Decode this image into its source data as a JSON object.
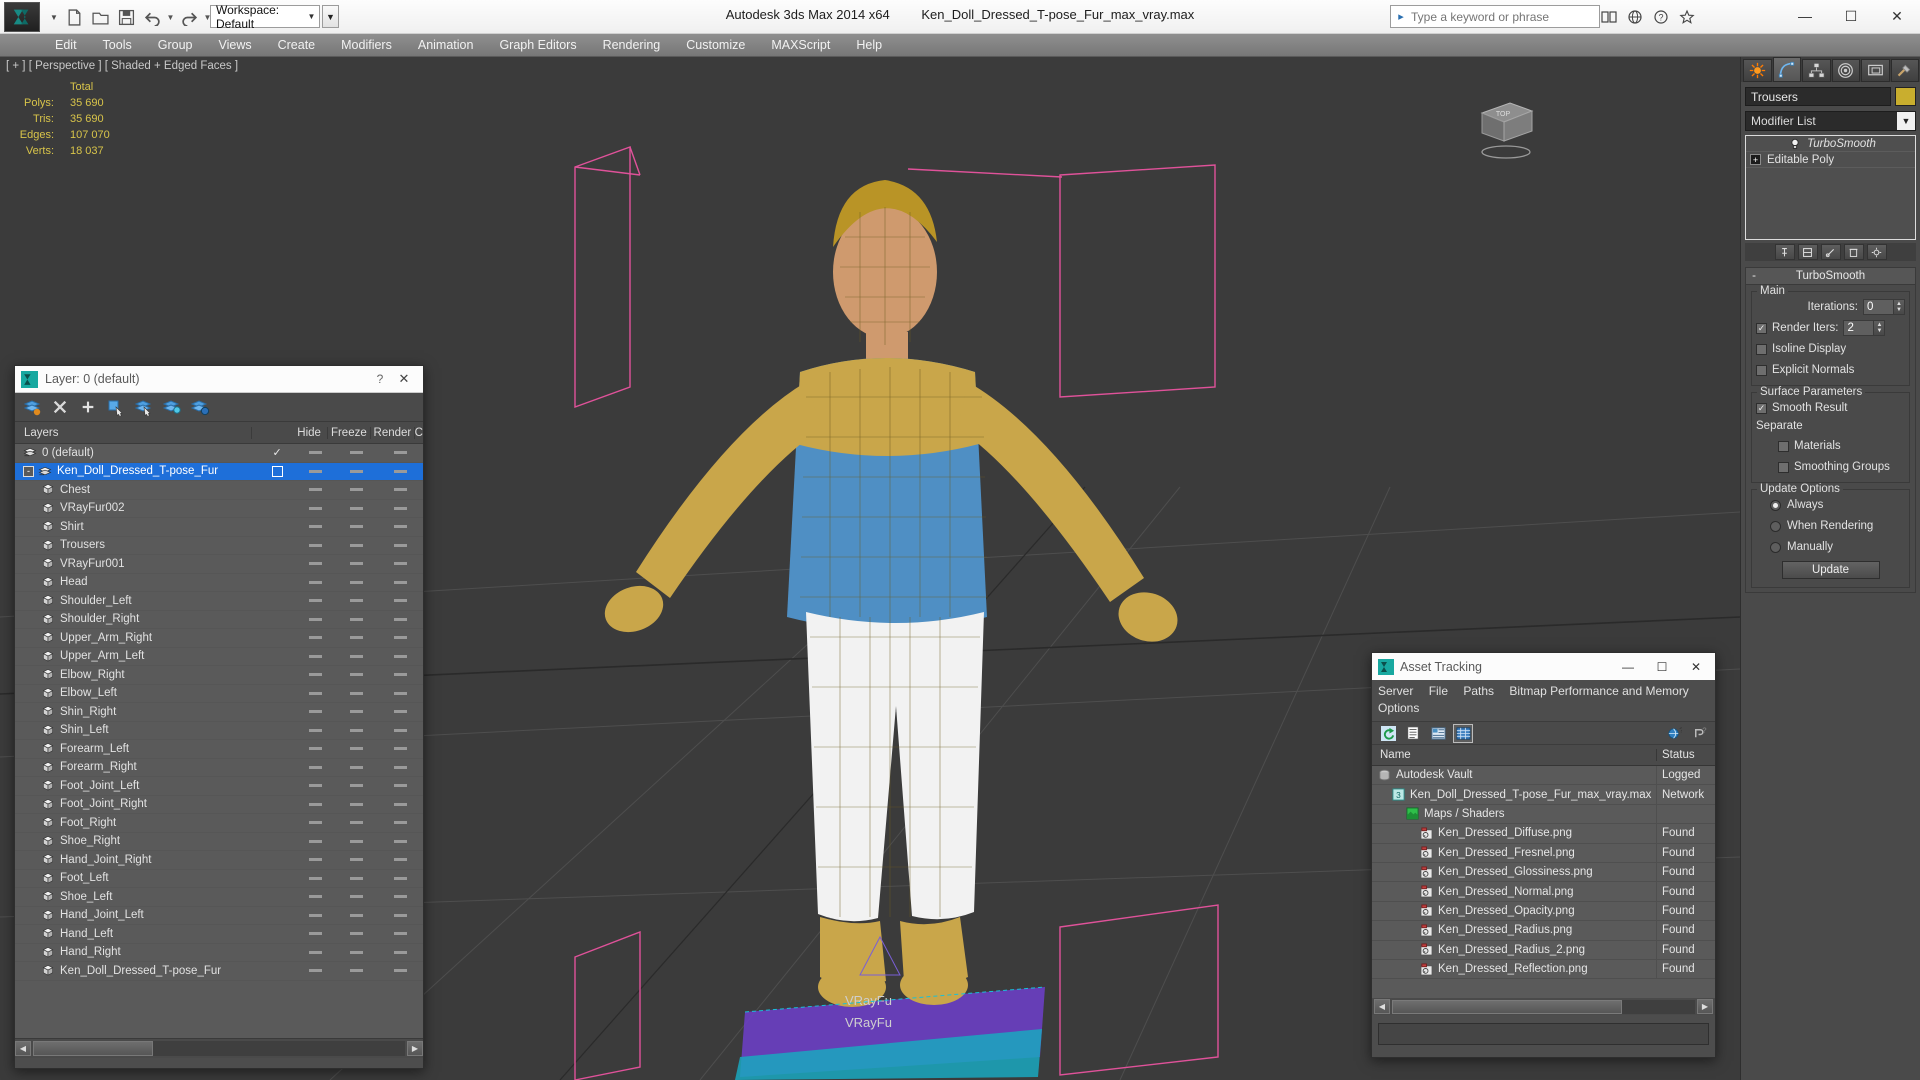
{
  "titlebar": {
    "app_title": "Autodesk 3ds Max  2014 x64",
    "file_title": "Ken_Doll_Dressed_T-pose_Fur_max_vray.max",
    "workspace": "Workspace: Default",
    "search_placeholder": "Type a keyword or phrase",
    "minimize": "—",
    "maximize": "☐",
    "close": "✕"
  },
  "menubar": {
    "items": [
      "Edit",
      "Tools",
      "Group",
      "Views",
      "Create",
      "Modifiers",
      "Animation",
      "Graph Editors",
      "Rendering",
      "Customize",
      "MAXScript",
      "Help"
    ]
  },
  "viewport": {
    "label": "[ + ] [ Perspective ] [ Shaded + Edged Faces ]",
    "stats_header": "Total",
    "stats": [
      {
        "label": "Polys:",
        "value": "35 690"
      },
      {
        "label": "Tris:",
        "value": "35 690"
      },
      {
        "label": "Edges:",
        "value": "107 070"
      },
      {
        "label": "Verts:",
        "value": "18 037"
      }
    ],
    "scene_labels": [
      "VRayFu",
      "VRayFu"
    ],
    "viewcube_label": "TOP"
  },
  "layer_dialog": {
    "title": "Layer: 0 (default)",
    "help_glyph": "?",
    "close_glyph": "✕",
    "columns": [
      "Layers",
      "",
      "Hide",
      "Freeze",
      "Render",
      "C"
    ],
    "rows": [
      {
        "name": "0 (default)",
        "indent": 0,
        "expander": "",
        "selected": false,
        "current": "check",
        "type": "layer"
      },
      {
        "name": "Ken_Doll_Dressed_T-pose_Fur",
        "indent": 0,
        "expander": "-",
        "selected": true,
        "current": "box",
        "type": "layer"
      },
      {
        "name": "Chest",
        "indent": 1,
        "type": "object"
      },
      {
        "name": "VRayFur002",
        "indent": 1,
        "type": "object"
      },
      {
        "name": "Shirt",
        "indent": 1,
        "type": "object"
      },
      {
        "name": "Trousers",
        "indent": 1,
        "type": "object"
      },
      {
        "name": "VRayFur001",
        "indent": 1,
        "type": "object"
      },
      {
        "name": "Head",
        "indent": 1,
        "type": "object"
      },
      {
        "name": "Shoulder_Left",
        "indent": 1,
        "type": "object"
      },
      {
        "name": "Shoulder_Right",
        "indent": 1,
        "type": "object"
      },
      {
        "name": "Upper_Arm_Right",
        "indent": 1,
        "type": "object"
      },
      {
        "name": "Upper_Arm_Left",
        "indent": 1,
        "type": "object"
      },
      {
        "name": "Elbow_Right",
        "indent": 1,
        "type": "object"
      },
      {
        "name": "Elbow_Left",
        "indent": 1,
        "type": "object"
      },
      {
        "name": "Shin_Right",
        "indent": 1,
        "type": "object"
      },
      {
        "name": "Shin_Left",
        "indent": 1,
        "type": "object"
      },
      {
        "name": "Forearm_Left",
        "indent": 1,
        "type": "object"
      },
      {
        "name": "Forearm_Right",
        "indent": 1,
        "type": "object"
      },
      {
        "name": "Foot_Joint_Left",
        "indent": 1,
        "type": "object"
      },
      {
        "name": "Foot_Joint_Right",
        "indent": 1,
        "type": "object"
      },
      {
        "name": "Foot_Right",
        "indent": 1,
        "type": "object"
      },
      {
        "name": "Shoe_Right",
        "indent": 1,
        "type": "object"
      },
      {
        "name": "Hand_Joint_Right",
        "indent": 1,
        "type": "object"
      },
      {
        "name": "Foot_Left",
        "indent": 1,
        "type": "object"
      },
      {
        "name": "Shoe_Left",
        "indent": 1,
        "type": "object"
      },
      {
        "name": "Hand_Joint_Left",
        "indent": 1,
        "type": "object"
      },
      {
        "name": "Hand_Left",
        "indent": 1,
        "type": "object"
      },
      {
        "name": "Hand_Right",
        "indent": 1,
        "type": "object"
      },
      {
        "name": "Ken_Doll_Dressed_T-pose_Fur",
        "indent": 1,
        "type": "object"
      }
    ],
    "toolbar_icons": [
      "new-layer-icon",
      "delete-layer-icon",
      "add-layer-icon",
      "select-objects-icon",
      "select-highlighted-layer-icon",
      "highlight-selected-objects-icon",
      "layer-properties-icon"
    ]
  },
  "asset_tracking": {
    "title": "Asset Tracking",
    "minimize": "—",
    "maximize": "☐",
    "close": "✕",
    "menu": [
      "Server",
      "File",
      "Paths",
      "Bitmap Performance and Memory",
      "Options"
    ],
    "toolbar_icons": [
      "refresh-icon",
      "list-view-icon",
      "detail-view-icon",
      "grid-view-icon",
      "help-globe-icon",
      "help-icon"
    ],
    "columns": [
      "Name",
      "Status"
    ],
    "rows": [
      {
        "name": "Autodesk Vault",
        "status": "Logged",
        "indent": 0,
        "icon": "vault-icon"
      },
      {
        "name": "Ken_Doll_Dressed_T-pose_Fur_max_vray.max",
        "status": "Network",
        "indent": 1,
        "icon": "max-file-icon"
      },
      {
        "name": "Maps / Shaders",
        "status": "",
        "indent": 2,
        "icon": "maps-icon"
      },
      {
        "name": "Ken_Dressed_Diffuse.png",
        "status": "Found",
        "indent": 3,
        "icon": "bitmap-icon"
      },
      {
        "name": "Ken_Dressed_Fresnel.png",
        "status": "Found",
        "indent": 3,
        "icon": "bitmap-icon"
      },
      {
        "name": "Ken_Dressed_Glossiness.png",
        "status": "Found",
        "indent": 3,
        "icon": "bitmap-icon"
      },
      {
        "name": "Ken_Dressed_Normal.png",
        "status": "Found",
        "indent": 3,
        "icon": "bitmap-icon"
      },
      {
        "name": "Ken_Dressed_Opacity.png",
        "status": "Found",
        "indent": 3,
        "icon": "bitmap-icon"
      },
      {
        "name": "Ken_Dressed_Radius.png",
        "status": "Found",
        "indent": 3,
        "icon": "bitmap-icon"
      },
      {
        "name": "Ken_Dressed_Radius_2.png",
        "status": "Found",
        "indent": 3,
        "icon": "bitmap-icon"
      },
      {
        "name": "Ken_Dressed_Reflection.png",
        "status": "Found",
        "indent": 3,
        "icon": "bitmap-icon"
      }
    ]
  },
  "command_panel": {
    "tabs": [
      "create-tab",
      "modify-tab",
      "hierarchy-tab",
      "motion-tab",
      "display-tab",
      "utilities-tab"
    ],
    "active_tab_index": 1,
    "object_name": "Trousers",
    "object_color": "#c9ae2e",
    "modifier_list_label": "Modifier List",
    "stack": [
      {
        "label": "TurboSmooth",
        "italic": true
      },
      {
        "label": "Editable Poly",
        "italic": false
      }
    ],
    "rollout": {
      "title": "TurboSmooth",
      "collapse_glyph": "-",
      "main_group": "Main",
      "iterations_label": "Iterations:",
      "iterations_value": "0",
      "render_iters_label": "Render Iters:",
      "render_iters_value": "2",
      "render_iters_checked": true,
      "isoline_label": "Isoline Display",
      "isoline_checked": false,
      "explicit_label": "Explicit Normals",
      "explicit_checked": false,
      "surface_group": "Surface Parameters",
      "smooth_result_label": "Smooth Result",
      "smooth_result_checked": true,
      "separate_label": "Separate",
      "materials_label": "Materials",
      "materials_checked": false,
      "smoothing_groups_label": "Smoothing Groups",
      "smoothing_groups_checked": false,
      "update_group": "Update Options",
      "update_options": [
        "Always",
        "When Rendering",
        "Manually"
      ],
      "update_selected": 0,
      "update_button": "Update"
    }
  }
}
